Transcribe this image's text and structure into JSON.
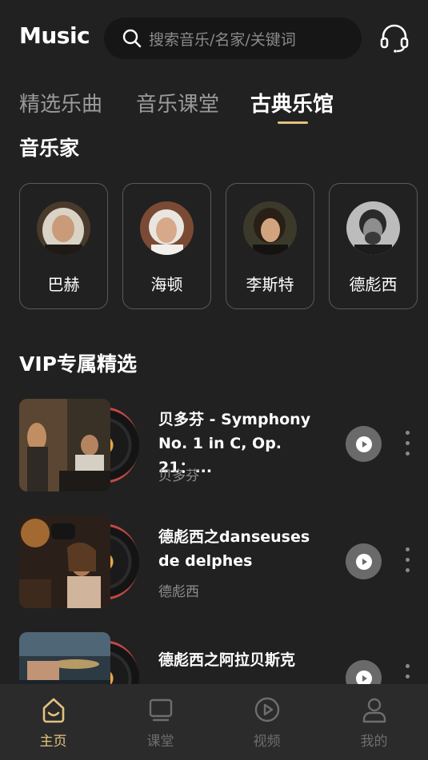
{
  "header": {
    "logo": "Music",
    "search_placeholder": "搜索音乐/名家/关键词",
    "support_icon": "headset-icon"
  },
  "tabs": [
    {
      "label": "精选乐曲",
      "active": false
    },
    {
      "label": "音乐课堂",
      "active": false
    },
    {
      "label": "古典乐馆",
      "active": true
    }
  ],
  "composers_section": {
    "title": "音乐家",
    "items": [
      {
        "name": "巴赫"
      },
      {
        "name": "海顿"
      },
      {
        "name": "李斯特"
      },
      {
        "name": "德彪西"
      }
    ]
  },
  "vip_section": {
    "title": "VIP专属精选",
    "tracks": [
      {
        "title": "贝多芬 - Symphony No. 1 in C, Op. 21：...",
        "artist": "贝多芬"
      },
      {
        "title": "德彪西之danseuses de delphes",
        "artist": "德彪西"
      },
      {
        "title": "德彪西之阿拉贝斯克",
        "artist": ""
      }
    ]
  },
  "bottom_nav": [
    {
      "label": "主页",
      "icon": "home-icon",
      "active": true
    },
    {
      "label": "课堂",
      "icon": "classroom-icon",
      "active": false
    },
    {
      "label": "视频",
      "icon": "video-icon",
      "active": false
    },
    {
      "label": "我的",
      "icon": "profile-icon",
      "active": false
    }
  ],
  "colors": {
    "background": "#212121",
    "accent": "#e2c27e",
    "nav_background": "#2b2b2b"
  }
}
